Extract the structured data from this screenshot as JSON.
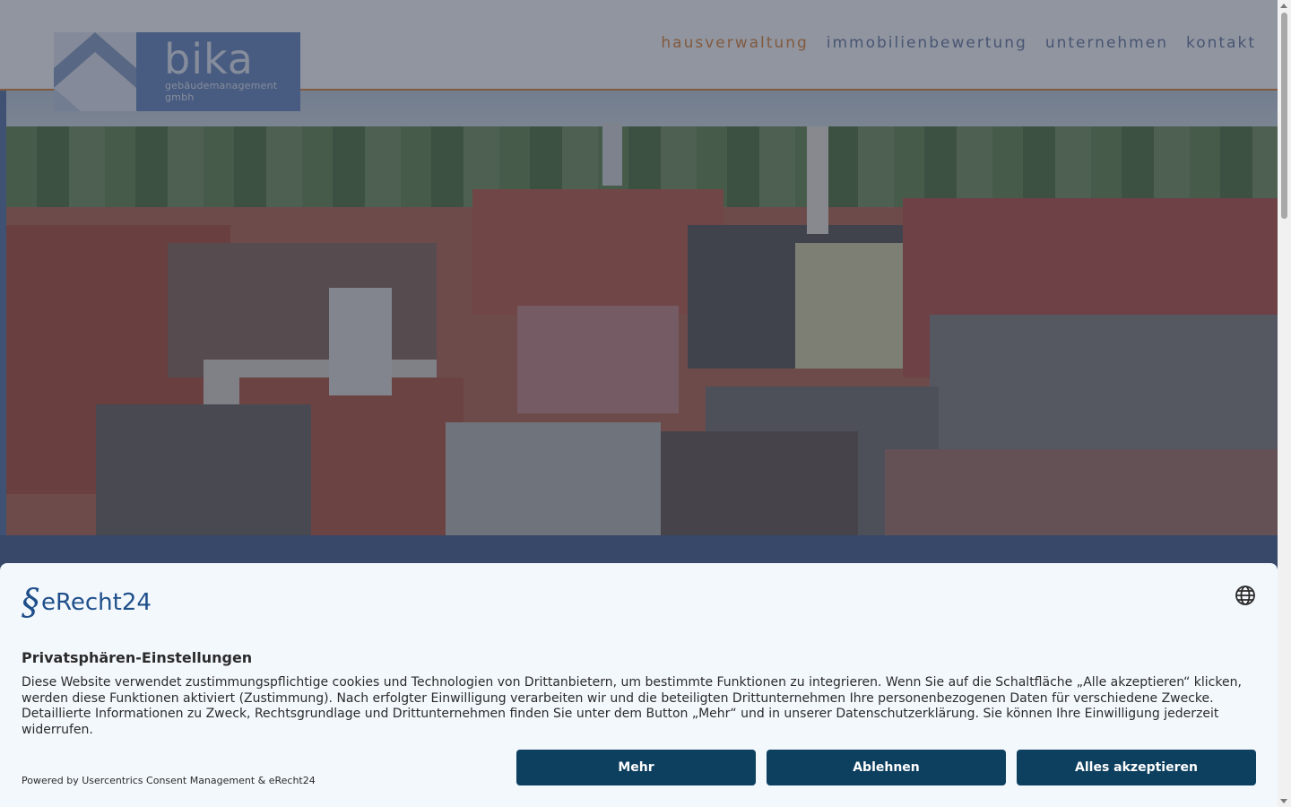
{
  "header": {
    "logo": {
      "name": "bika",
      "subtitle_line1": "gebäudemanagement",
      "subtitle_line2": "gmbh"
    },
    "nav": [
      {
        "label": "hausverwaltung",
        "active": true
      },
      {
        "label": "immobilienbewertung",
        "active": false
      },
      {
        "label": "unternehmen",
        "active": false
      },
      {
        "label": "kontakt",
        "active": false
      }
    ]
  },
  "colors": {
    "accent": "#e2893d",
    "nav": "#6f7fa3",
    "button": "#0d3f5f",
    "banner_bg": "#f3f8fd"
  },
  "consent": {
    "brand": "eRecht24",
    "brand_mark": "§",
    "language_icon": "globe-icon",
    "title": "Privatsphären-Einstellungen",
    "body": "Diese Website verwendet zustimmungspflichtige cookies und Technologien von Drittanbietern, um bestimmte Funktionen zu integrieren. Wenn Sie auf die Schaltfläche „Alle akzeptieren“ klicken, werden diese Funktionen aktiviert (Zustimmung). Nach erfolgter Einwilligung verarbeiten wir und die beteiligten Drittunternehmen Ihre personenbezogenen Daten für verschiedene Zwecke. Detaillierte Informationen zu Zweck, Rechtsgrundlage und Drittunternehmen finden Sie unter dem Button „Mehr“ und in unserer Datenschutzerklärung. Sie können Ihre Einwilligung jederzeit widerrufen.",
    "powered_by": "Powered by Usercentrics Consent Management & eRecht24",
    "buttons": {
      "more": "Mehr",
      "deny": "Ablehnen",
      "accept": "Alles akzeptieren"
    }
  }
}
